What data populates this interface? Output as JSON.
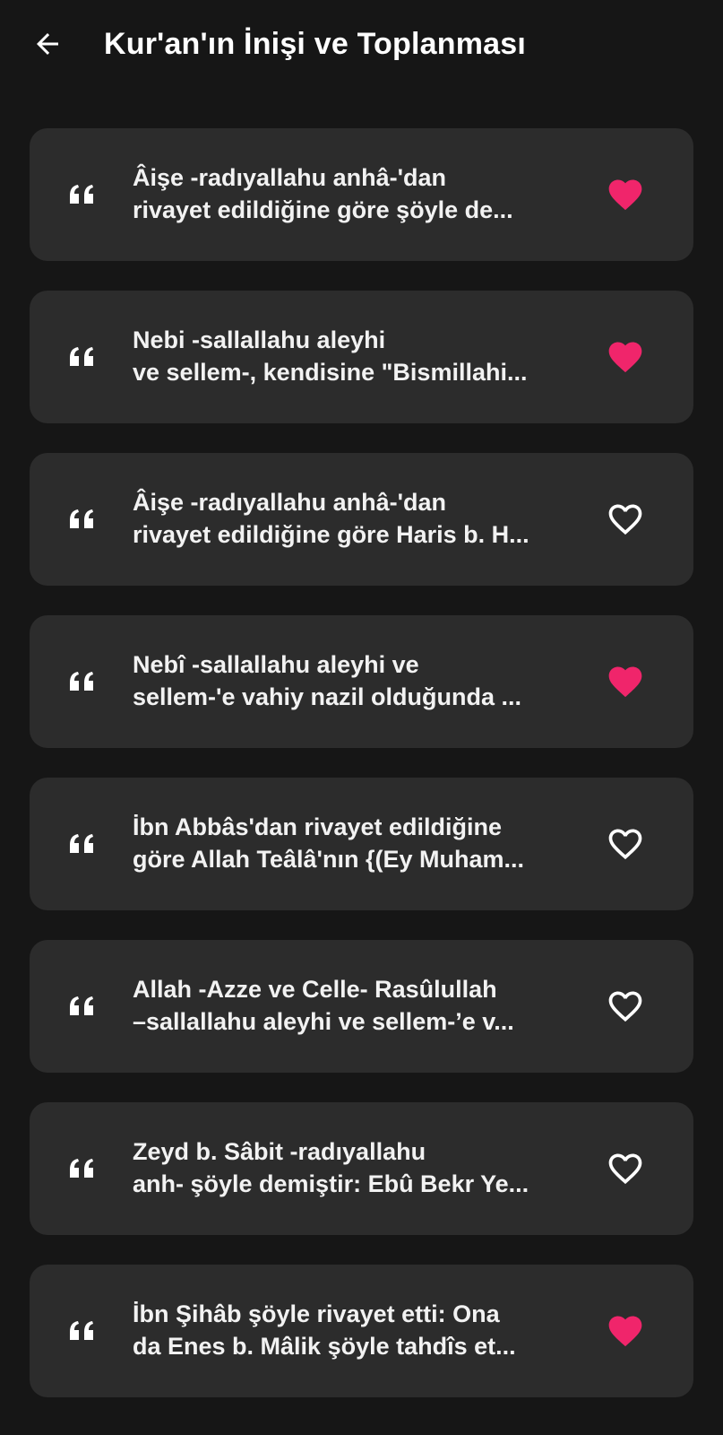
{
  "header": {
    "back_icon": "arrow-left-icon",
    "title": "Kur'an'ın İnişi ve Toplanması"
  },
  "colors": {
    "background": "#161616",
    "card": "#2c2c2c",
    "favorite_active": "#f0256b",
    "text": "#f2f2f2"
  },
  "items": [
    {
      "line1": "Âişe -radıyallahu anhâ-'dan",
      "line2": "rivayet edildiğine göre şöyle de...",
      "favorite": true
    },
    {
      "line1": "Nebi -sallallahu aleyhi",
      "line2": "ve sellem-, kendisine \"Bismillahi...",
      "favorite": true
    },
    {
      "line1": "Âişe -radıyallahu anhâ-'dan",
      "line2": "rivayet edildiğine göre Haris b. H...",
      "favorite": false
    },
    {
      "line1": "Nebî -sallallahu aleyhi ve",
      "line2": "sellem-'e vahiy nazil olduğunda ...",
      "favorite": true
    },
    {
      "line1": "İbn Abbâs'dan rivayet edildiğine",
      "line2": "göre Allah Teâlâ'nın {(Ey Muham...",
      "favorite": false
    },
    {
      "line1": "Allah -Azze ve Celle- Rasûlullah",
      "line2": "–sallallahu aleyhi ve sellem-’e v...",
      "favorite": false
    },
    {
      "line1": "Zeyd b. Sâbit -radıyallahu",
      "line2": "anh- şöyle demiştir: Ebû Bekr Ye...",
      "favorite": false
    },
    {
      "line1": "İbn Şihâb şöyle rivayet etti: Ona",
      "line2": "da Enes b. Mâlik şöyle tahdîs et...",
      "favorite": true
    }
  ]
}
